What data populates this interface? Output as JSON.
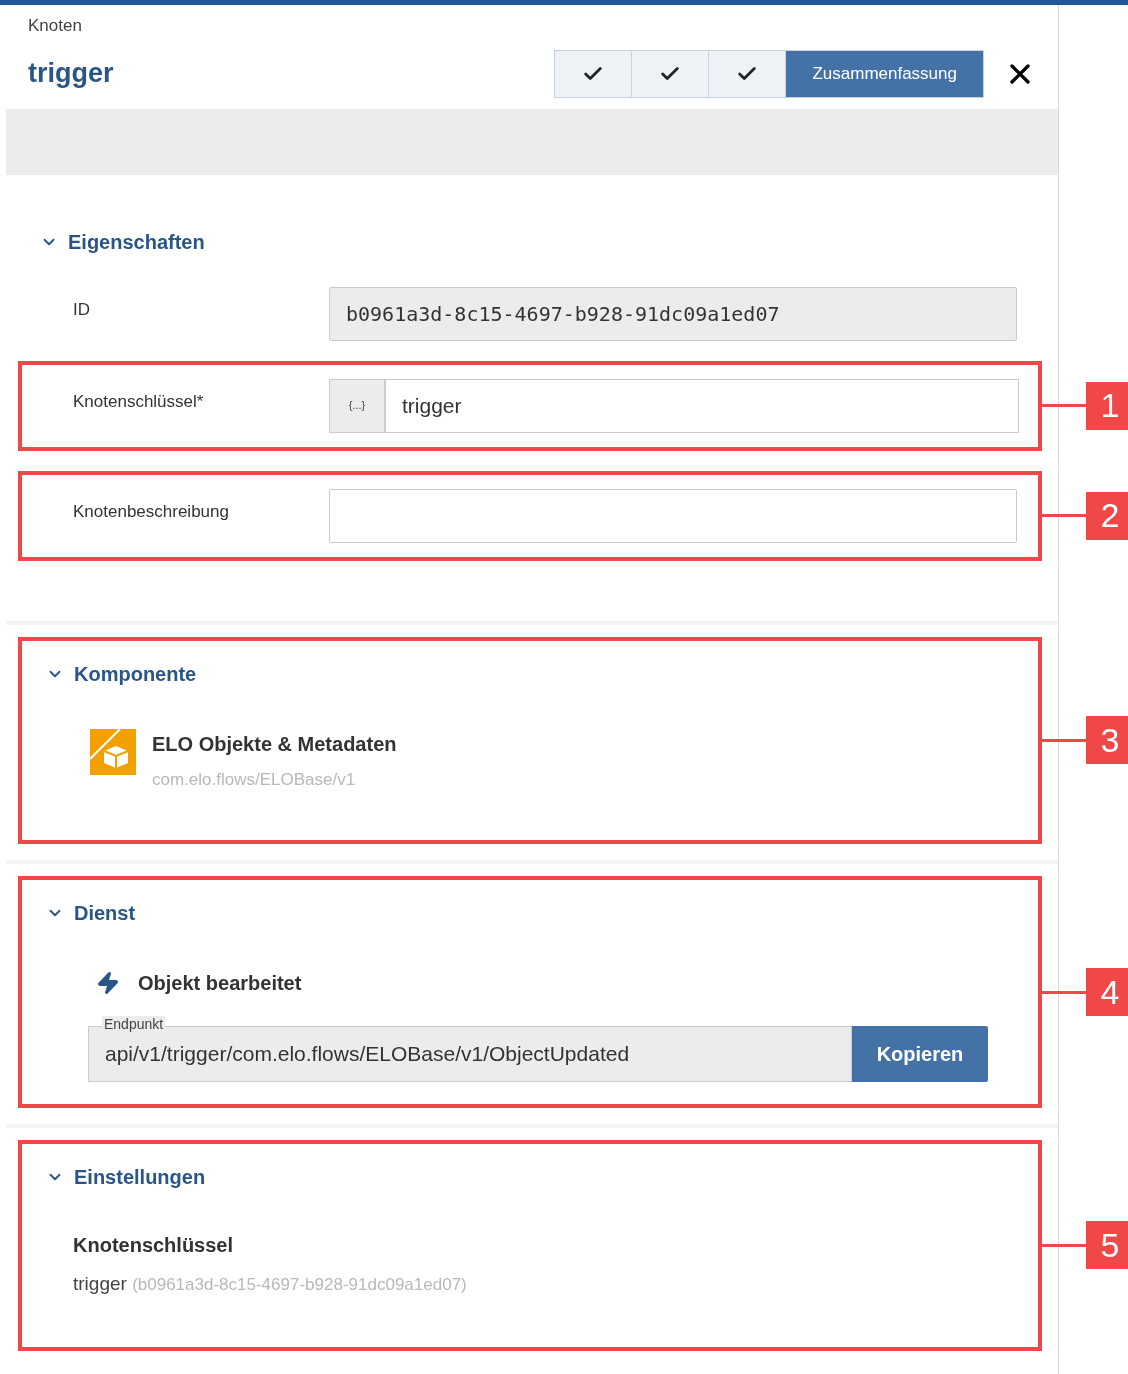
{
  "breadcrumb": "Knoten",
  "title": "trigger",
  "steps": [
    {
      "kind": "done",
      "selected": false
    },
    {
      "kind": "done",
      "selected": false
    },
    {
      "kind": "done",
      "selected": false
    },
    {
      "kind": "label",
      "label": "Zusammenfassung",
      "selected": true
    }
  ],
  "sections": [
    {
      "kind": "fields",
      "title": "Eigenschaften",
      "expanded": true,
      "fields": [
        {
          "kind": "readonly",
          "label": "ID",
          "value": "b0961a3d-8c15-4697-b928-91dc09a1ed07"
        },
        {
          "kind": "expression",
          "label": "Knotenschlüssel*",
          "prefix": "{...}",
          "value": "trigger",
          "callout": "1"
        },
        {
          "kind": "text",
          "label": "Knotenbeschreibung",
          "callout": "2"
        }
      ]
    },
    {
      "kind": "component",
      "title": "Komponente",
      "expanded": true,
      "callout": "3",
      "name": "ELO Objekte & Metadaten",
      "path": "com.elo.flows/ELOBase/v1"
    },
    {
      "kind": "service",
      "title": "Dienst",
      "expanded": true,
      "callout": "4",
      "name": "Objekt bearbeitet",
      "endpoint_label": "Endpunkt",
      "endpoint": "api/v1/trigger/com.elo.flows/ELOBase/v1/ObjectUpdated",
      "button": "Kopieren"
    },
    {
      "kind": "settings",
      "title": "Einstellungen",
      "expanded": true,
      "callout": "5",
      "label": "Knotenschlüssel",
      "value": "trigger",
      "id": "(b0961a3d-8c15-4697-b928-91dc09a1ed07)"
    }
  ]
}
